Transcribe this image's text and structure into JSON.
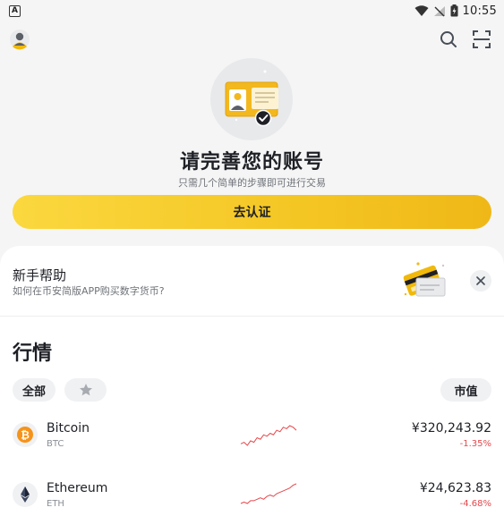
{
  "status_bar": {
    "notification_icon": "a-letter-icon",
    "time": "10:55",
    "icons": [
      "wifi-icon",
      "no-signal-icon",
      "battery-icon"
    ]
  },
  "topbar": {
    "avatar": "user-avatar-icon",
    "search": "search-icon",
    "scan": "scan-icon"
  },
  "hero": {
    "title": "请完善您的账号",
    "subtitle": "只需几个简单的步骤即可进行交易",
    "button_label": "去认证"
  },
  "help_card": {
    "title": "新手帮助",
    "subtitle": "如何在币安简版APP购买数字货币?"
  },
  "market": {
    "title": "行情",
    "filter_all": "全部",
    "sort_label": "市值",
    "rows": [
      {
        "name": "Bitcoin",
        "symbol": "BTC",
        "price": "¥320,243.92",
        "change": "-1.35%",
        "spark": [
          6,
          7,
          5,
          8,
          7,
          10,
          9,
          12,
          11,
          13,
          12,
          15,
          14,
          17,
          16,
          18,
          17,
          15
        ]
      },
      {
        "name": "Ethereum",
        "symbol": "ETH",
        "price": "¥24,623.83",
        "change": "-4.68%",
        "spark": [
          4,
          5,
          4,
          6,
          6,
          7,
          8,
          7,
          9,
          10,
          9,
          11,
          12,
          13,
          14,
          15,
          17,
          18
        ]
      }
    ]
  },
  "colors": {
    "accent": "#f0b90b",
    "negative": "#e5484d",
    "text": "#1e2026",
    "muted": "#6f7379"
  }
}
